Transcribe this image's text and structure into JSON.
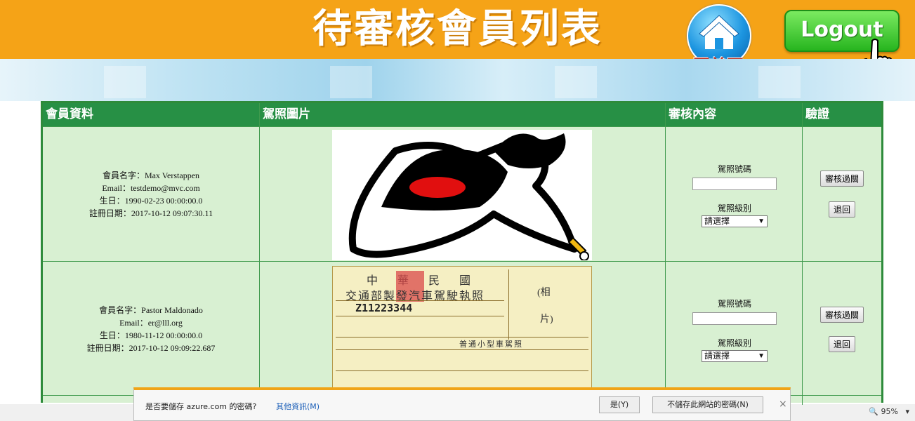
{
  "header": {
    "title": "待審核會員列表",
    "home_label": "回首頁",
    "logout_label": "Logout"
  },
  "table": {
    "columns": [
      "會員資料",
      "駕照圖片",
      "審核內容",
      "驗證"
    ],
    "rows": [
      {
        "name_line": "會員名字：Max Verstappen",
        "email_line": "Email：testdemo@mvc.com",
        "birth_line": "生日：1990-02-23 00:00:00.0",
        "reg_line": "註冊日期：2017-10-12 09:07:30.11",
        "license_label": "駕照號碼",
        "level_label": "駕照級別",
        "level_value": "請選擇",
        "approve_label": "審核過關",
        "reject_label": "退回"
      },
      {
        "name_line": "會員名字：Pastor Maldonado",
        "email_line": "Email：er@lll.org",
        "birth_line": "生日：1980-11-12 00:00:00.0",
        "reg_line": "註冊日期：2017-10-12 09:09:22.687",
        "license_label": "駕照號碼",
        "level_label": "駕照級別",
        "level_value": "請選擇",
        "approve_label": "審核過關",
        "reject_label": "退回",
        "license_card": {
          "line1": "中　華　民　國",
          "line2": "交通部製發汽車駕駛執照",
          "number": "Z11223344",
          "photo_label_1": "(相",
          "photo_label_2": "片)",
          "type": "普通小型車駕照"
        }
      }
    ]
  },
  "password_bar": {
    "question": "是否要儲存 azure.com 的密碼?",
    "more_info": "其他資訊(M)",
    "yes": "是(Y)",
    "never": "不儲存此網站的密碼(N)",
    "close": "×"
  },
  "status": {
    "zoom": "95%"
  }
}
